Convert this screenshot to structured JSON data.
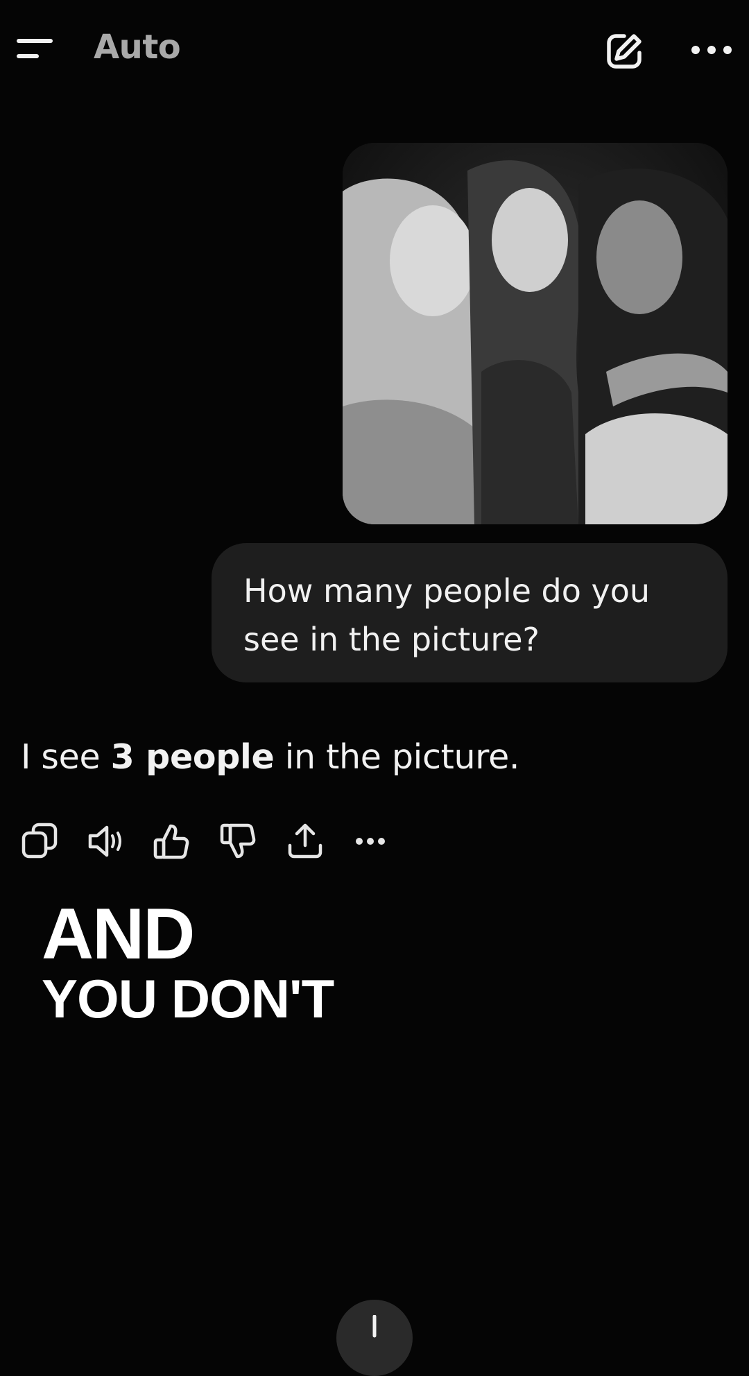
{
  "header": {
    "model_title": "Auto",
    "menu_icon": "hamburger-menu-icon",
    "new_chat_icon": "compose-icon",
    "more_icon": "more-dots-icon"
  },
  "conversation": {
    "user_image_alt": "",
    "user_message": "How many people do you see in the picture?",
    "assistant_message": {
      "prefix": "I see ",
      "bold": "3 people",
      "suffix": " in the picture."
    },
    "actions": [
      {
        "icon": "copy-icon"
      },
      {
        "icon": "read-aloud-icon"
      },
      {
        "icon": "thumbs-up-icon"
      },
      {
        "icon": "thumbs-down-icon"
      },
      {
        "icon": "share-icon"
      },
      {
        "icon": "more-dots-icon"
      }
    ]
  },
  "caption": {
    "line1": "AND",
    "line2": "YOU DON'T"
  },
  "colors": {
    "background": "#050505",
    "bubble": "#1e1e1e",
    "title": "#a9a9a9",
    "text": "#f2f2f2"
  }
}
